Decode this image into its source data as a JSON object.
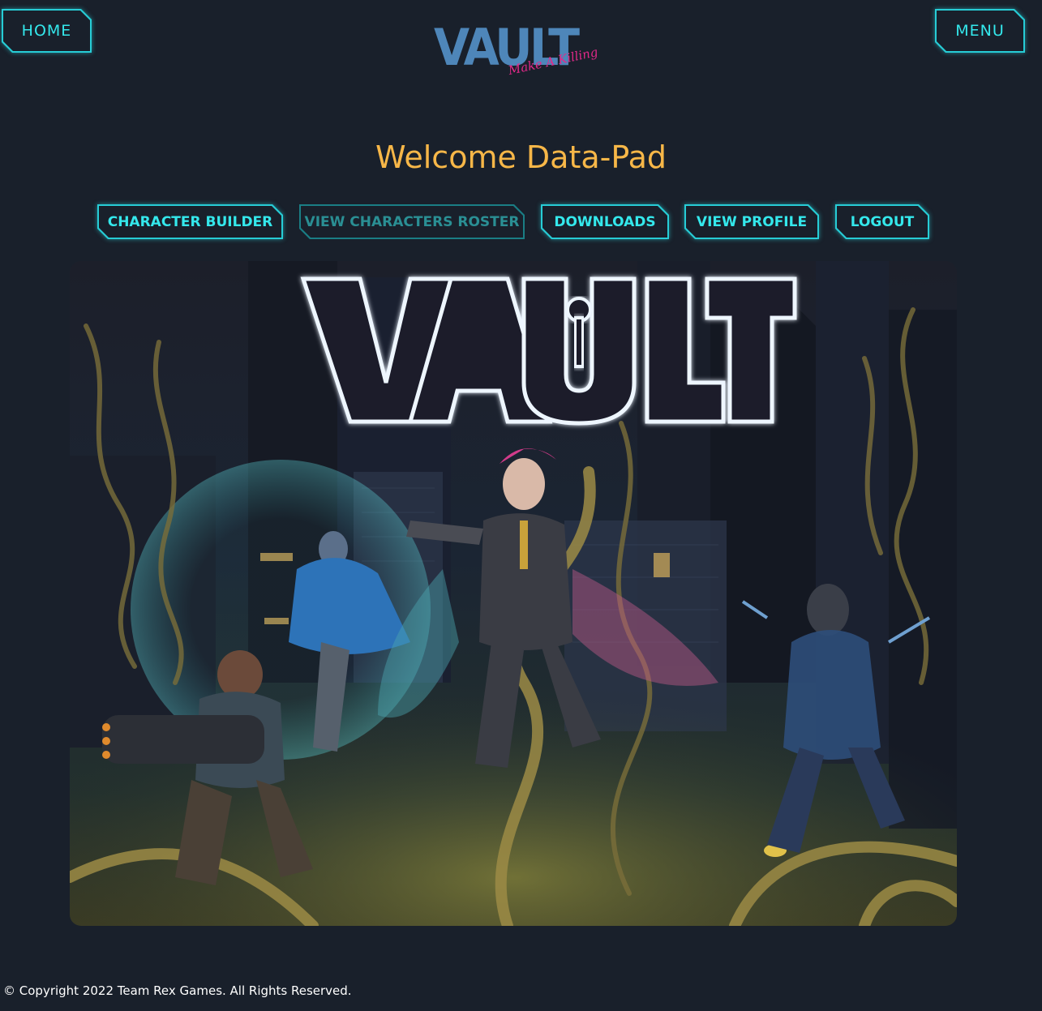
{
  "header": {
    "home_label": "HOME",
    "menu_label": "MENU",
    "logo_word": "VAULT",
    "logo_tagline": "Make A Killing"
  },
  "welcome_title": "Welcome Data-Pad",
  "nav": [
    {
      "label": "CHARACTER BUILDER",
      "active": true
    },
    {
      "label": "VIEW CHARACTERS ROSTER",
      "active": false
    },
    {
      "label": "DOWNLOADS",
      "active": true
    },
    {
      "label": "VIEW PROFILE",
      "active": true
    },
    {
      "label": "LOGOUT",
      "active": true
    }
  ],
  "hero": {
    "title_text": "VAULT"
  },
  "footer": {
    "copyright": "© Copyright 2022 Team Rex Games. All Rights Reserved."
  },
  "colors": {
    "background": "#19202b",
    "neon": "#2ee6ea",
    "welcome": "#f7b748",
    "logo_blue": "#4e86b9",
    "logo_pink": "#e3298a"
  }
}
